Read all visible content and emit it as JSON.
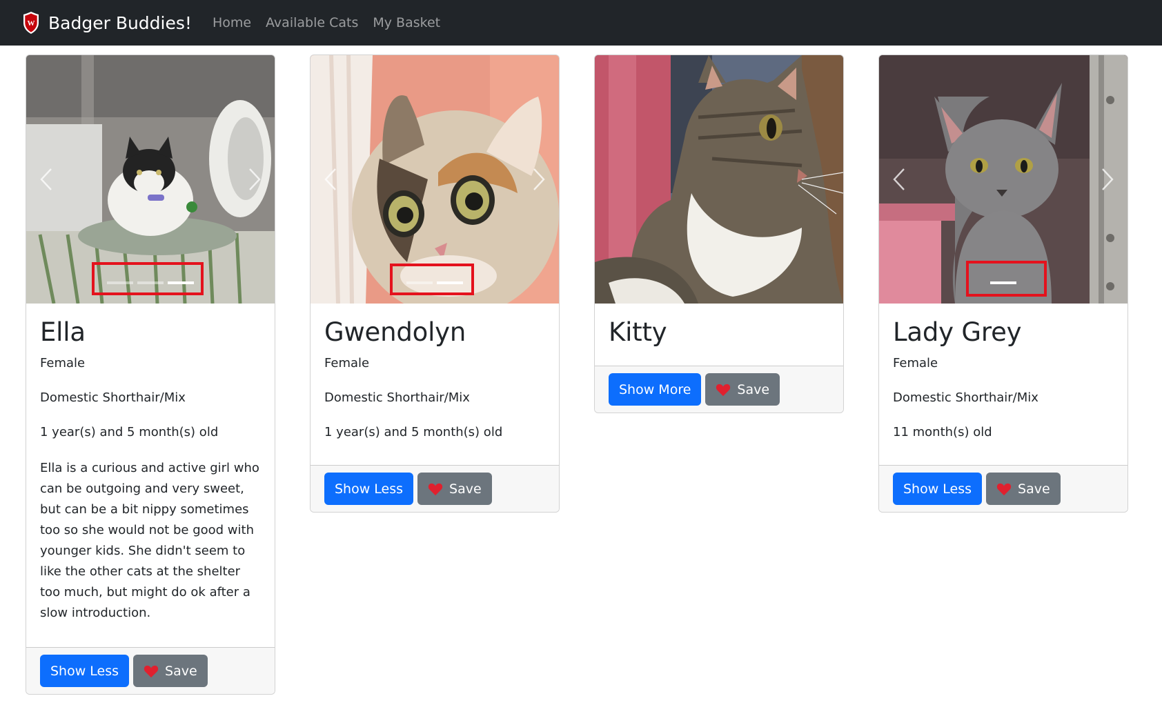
{
  "navbar": {
    "brand": "Badger Buddies!",
    "links": [
      "Home",
      "Available Cats",
      "My Basket"
    ]
  },
  "cards": [
    {
      "name": "Ella",
      "gender": "Female",
      "breed": "Domestic Shorthair/Mix",
      "age": "1 year(s) and 5 month(s) old",
      "description": "Ella is a curious and active girl who can be outgoing and very sweet, but can be a bit nippy sometimes too so she would not be good with younger kids. She didn't seem to like the other cats at the shelter too much, but might do ok after a slow introduction.",
      "toggle_label": "Show Less",
      "save_label": "Save"
    },
    {
      "name": "Gwendolyn",
      "gender": "Female",
      "breed": "Domestic Shorthair/Mix",
      "age": "1 year(s) and 5 month(s) old",
      "toggle_label": "Show Less",
      "save_label": "Save"
    },
    {
      "name": "Kitty",
      "toggle_label": "Show More",
      "save_label": "Save"
    },
    {
      "name": "Lady Grey",
      "gender": "Female",
      "breed": "Domestic Shorthair/Mix",
      "age": "11 month(s) old",
      "toggle_label": "Show Less",
      "save_label": "Save"
    }
  ],
  "colors": {
    "navbar_bg": "#212529",
    "primary": "#0d6efd",
    "secondary": "#6c757d",
    "highlight": "#e4121d"
  },
  "icons": [
    "uw-crest-logo",
    "heart-icon",
    "chevron-left-icon",
    "chevron-right-icon"
  ]
}
